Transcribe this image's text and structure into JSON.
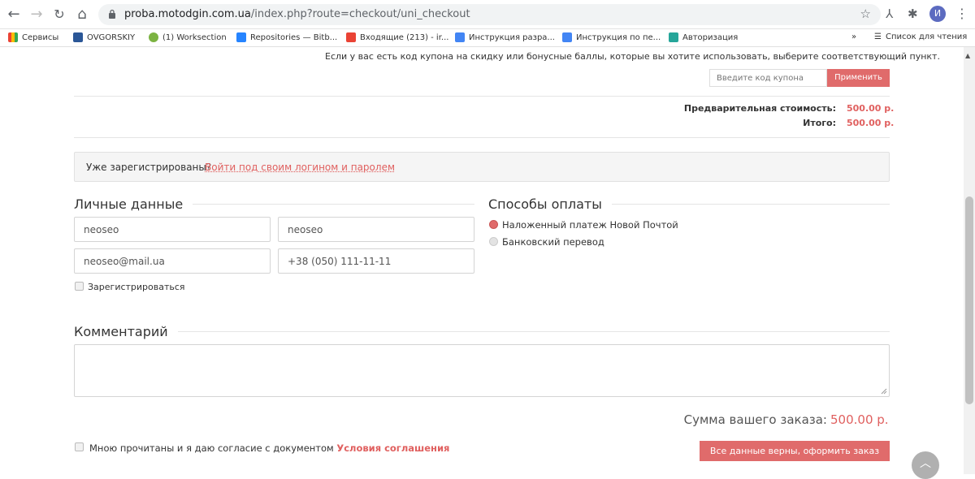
{
  "browser": {
    "url_host": "proba.motodgin.com.ua",
    "url_path": "/index.php?route=checkout/uni_checkout",
    "profile_initial": "И",
    "bookmarks": [
      {
        "label": "Сервисы",
        "color": "#4285f4"
      },
      {
        "label": "OVGORSKIY",
        "color": "#2b5797"
      },
      {
        "label": "(1) Worksection",
        "color": "#7cb342"
      },
      {
        "label": "Repositories — Bitb...",
        "color": "#2684ff"
      },
      {
        "label": "Входящие (213) - ir...",
        "color": "#ea4335"
      },
      {
        "label": "Инструкция разра...",
        "color": "#4285f4"
      },
      {
        "label": "Инструкция по пе...",
        "color": "#4285f4"
      },
      {
        "label": "Авторизация",
        "color": "#26a69a"
      }
    ],
    "bookmarks_more": "»",
    "reading_list": "Список для чтения"
  },
  "coupon": {
    "text": "Если у вас есть код купона на скидку или бонусные баллы, которые вы хотите использовать, выберите соответствующий пункт.",
    "placeholder": "Введите код купона",
    "apply_label": "Применить"
  },
  "totals": {
    "subtotal_label": "Предварительная стоимость:",
    "subtotal_value": "500.00 р.",
    "total_label": "Итого:",
    "total_value": "500.00 р."
  },
  "login": {
    "question": "Уже зарегистрированы?",
    "link": "Войти под своим логином и паролем"
  },
  "personal": {
    "title": "Личные данные",
    "first_name": "neoseo",
    "last_name": "neoseo",
    "email": "neoseo@mail.ua",
    "phone": "+38 (050) 111-11-11",
    "register_label": "Зарегистрироваться"
  },
  "payment": {
    "title": "Способы оплаты",
    "options": [
      {
        "label": "Наложенный платеж Новой Почтой",
        "selected": true
      },
      {
        "label": "Банковский перевод",
        "selected": false
      }
    ]
  },
  "comment": {
    "title": "Комментарий"
  },
  "summary": {
    "label": "Сумма вашего заказа:",
    "value": "500.00 р."
  },
  "agreement": {
    "text": "Мною прочитаны и я даю согласие с документом",
    "link": "Условия соглашения"
  },
  "order_button": "Все данные верны, оформить заказ",
  "colors": {
    "accent": "#e0605f",
    "button": "#e06b6b"
  }
}
